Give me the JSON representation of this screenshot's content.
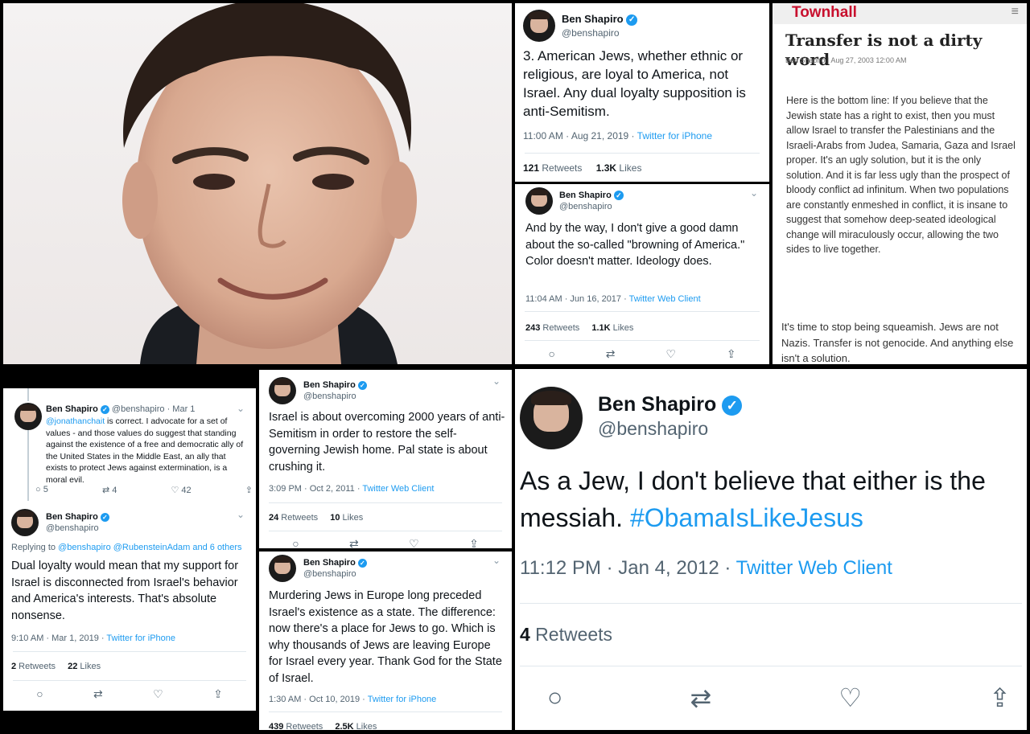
{
  "colors": {
    "accent": "#1d9bf0",
    "border": "#000000",
    "townhall_red": "#c8102e"
  },
  "icons": [
    "reply-icon",
    "retweet-icon",
    "like-icon",
    "share-icon",
    "verified-icon",
    "chevron-down-icon"
  ],
  "tweet_a": {
    "name": "Ben Shapiro",
    "handle": "@benshapiro",
    "text": "3. American Jews, whether ethnic or religious, are loyal to America, not Israel. Any dual loyalty supposition is anti-Semitism.",
    "time": "11:00 AM · Aug 21, 2019 · ",
    "source": "Twitter for iPhone",
    "retweets_count": "121",
    "retweets_label": " Retweets",
    "likes_count": "1.3K",
    "likes_label": " Likes"
  },
  "townhall": {
    "logo": "Townhall",
    "title": "Transfer is not a dirty word",
    "byline": "Ben Shapiro  |  Aug 27, 2003 12:00 AM",
    "paragraph1": "Here is the bottom line: If you believe that the Jewish state has a right to exist, then you must allow Israel to transfer the Palestinians and the Israeli-Arabs from Judea, Samaria, Gaza and Israel proper. It's an ugly solution, but it is the only solution. And it is far less ugly than the prospect of bloody conflict ad infinitum. When two populations are constantly enmeshed in conflict, it is insane to suggest that somehow deep-seated ideological change will miraculously occur, allowing the two sides to live together.",
    "paragraph2": "It's time to stop being squeamish. Jews are not Nazis. Transfer is not genocide. And anything else isn't a solution."
  },
  "tweet_b": {
    "name": "Ben Shapiro",
    "handle": "@benshapiro",
    "text": "And by the way, I don't give a good damn about the so-called \"browning of America.\" Color doesn't matter. Ideology does.",
    "time": "11:04 AM · Jun 16, 2017 · ",
    "source": "Twitter Web Client",
    "retweets_count": "243",
    "retweets_label": " Retweets",
    "likes_count": "1.1K",
    "likes_label": " Likes"
  },
  "tweet_c": {
    "parent": {
      "name": "Ben Shapiro",
      "handle": "@benshapiro · Mar 1",
      "mention": "@jonathanchait",
      "text": " is correct. I advocate for a set of values - and those values do suggest that standing against the existence of a free and democratic ally of the United States in the Middle East, an ally that exists to protect Jews against extermination, is a moral evil.",
      "replies": "5",
      "retweets": "4",
      "likes": "42"
    },
    "name": "Ben Shapiro",
    "handle": "@benshapiro",
    "replying_prefix": "Replying to ",
    "replying_to": "@benshapiro @RubensteinAdam and 6 others",
    "text": "Dual loyalty would mean that my support for Israel is disconnected from Israel's behavior and America's interests. That's absolute nonsense.",
    "time": "9:10 AM · Mar 1, 2019 · ",
    "source": "Twitter for iPhone",
    "retweets_count": "2",
    "retweets_label": " Retweets",
    "likes_count": "22",
    "likes_label": " Likes"
  },
  "tweet_d": {
    "name": "Ben Shapiro",
    "handle": "@benshapiro",
    "text": "Israel is about overcoming 2000 years of anti-Semitism in order to restore the self-governing Jewish home. Pal state is about crushing it.",
    "time": "3:09 PM · Oct 2, 2011 · ",
    "source": "Twitter Web Client",
    "retweets_count": "24",
    "retweets_label": " Retweets",
    "likes_count": "10",
    "likes_label": " Likes"
  },
  "tweet_e": {
    "name": "Ben Shapiro",
    "handle": "@benshapiro",
    "text": "Murdering Jews in Europe long preceded Israel's existence as a state. The difference: now there's a place for Jews to go. Which is why thousands of Jews are leaving Europe for Israel every year. Thank God for the State of Israel.",
    "time": "1:30 AM · Oct 10, 2019 · ",
    "source": "Twitter for iPhone",
    "retweets_count": "439",
    "retweets_label": " Retweets",
    "likes_count": "2.5K",
    "likes_label": " Likes"
  },
  "tweet_f": {
    "name": "Ben Shapiro",
    "handle": "@benshapiro",
    "text": "As a Jew, I don't believe that either is the messiah. ",
    "hashtag": "#ObamaIsLikeJesus",
    "time": "11:12 PM · Jan 4, 2012 · ",
    "source": "Twitter Web Client",
    "retweets_count": "4",
    "retweets_label": " Retweets"
  }
}
